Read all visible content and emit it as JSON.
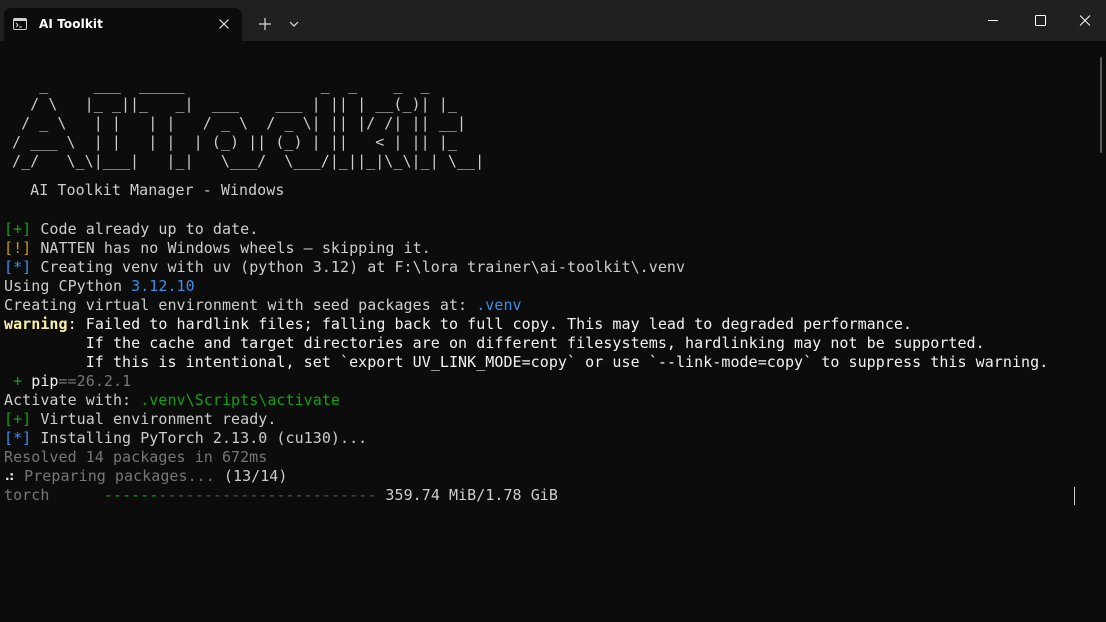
{
  "titlebar": {
    "tab_title": "AI Toolkit",
    "tab_icon": "terminal-icon",
    "close_tab_icon": "close-icon",
    "new_tab_icon": "plus-icon",
    "dropdown_icon": "chevron-down-icon",
    "minimize_icon": "minimize-icon",
    "maximize_icon": "maximize-icon",
    "close_window_icon": "close-icon"
  },
  "banner": {
    "ascii_art": "   _     ___  _____               _  _    _  _   \n  / \\   |_ _||_   _|  ___    ___ | || | __(_)| |_ \n / _ \\   | |   | |   / _ \\  / _ \\| || |/ /| || __|\n/ ___ \\  | |   | |  | (_) || (_) | ||   < | || |_ \n/_/   \\_\\|___|   |_|   \\___/  \\___/|_||_|\\_\\|_| \\__|",
    "subtitle": "  AI Toolkit Manager - Windows"
  },
  "lines": {
    "l1_tag": "[+]",
    "l1_text": " Code already up to date.",
    "l2_tag": "[!]",
    "l2_text": " NATTEN has no Windows wheels — skipping it.",
    "l3_tag": "[*]",
    "l3_text": " Creating venv with uv (python 3.12) at F:\\lora trainer\\ai-toolkit\\.venv",
    "l4_prefix": "Using CPython ",
    "l4_version": "3.12.10",
    "l5_prefix": "Creating virtual environment with seed packages at: ",
    "l5_path": ".venv",
    "l6_label": "warning",
    "l6_text": ": Failed to hardlink files; falling back to full copy. This may lead to degraded performance.",
    "l7_text": "         If the cache and target directories are on different filesystems, hardlinking may not be supported.",
    "l8_text": "         If this is intentional, set `export UV_LINK_MODE=copy` or use `--link-mode=copy` to suppress this warning.",
    "l9_plus": " + ",
    "l9_pkg": "pip",
    "l9_ver": "==26.2.1",
    "l10_prefix": "Activate with: ",
    "l10_cmd": ".venv\\Scripts\\activate",
    "l11_tag": "[+]",
    "l11_text": " Virtual environment ready.",
    "l12_tag": "[*]",
    "l12_text": " Installing PyTorch 2.13.0 (cu130)...",
    "l13_text": "Resolved 14 packages in 672ms",
    "l14_spinner": "⠴",
    "l14_text": " Preparing packages... ",
    "l14_count": "(13/14)",
    "l15_pkg": "torch      ",
    "l15_bar_done": "------",
    "l15_bar_rest": "------------------------",
    "l15_size": " 359.74 MiB/1.78 GiB"
  },
  "download_progress": {
    "package": "torch",
    "downloaded": "359.74 MiB",
    "total": "1.78 GiB",
    "fraction": 0.2
  },
  "colors": {
    "background": "#0c0c0c",
    "titlebar": "#202020",
    "green": "#13a10e",
    "yellow": "#c19c00",
    "blue": "#3b8eea"
  }
}
